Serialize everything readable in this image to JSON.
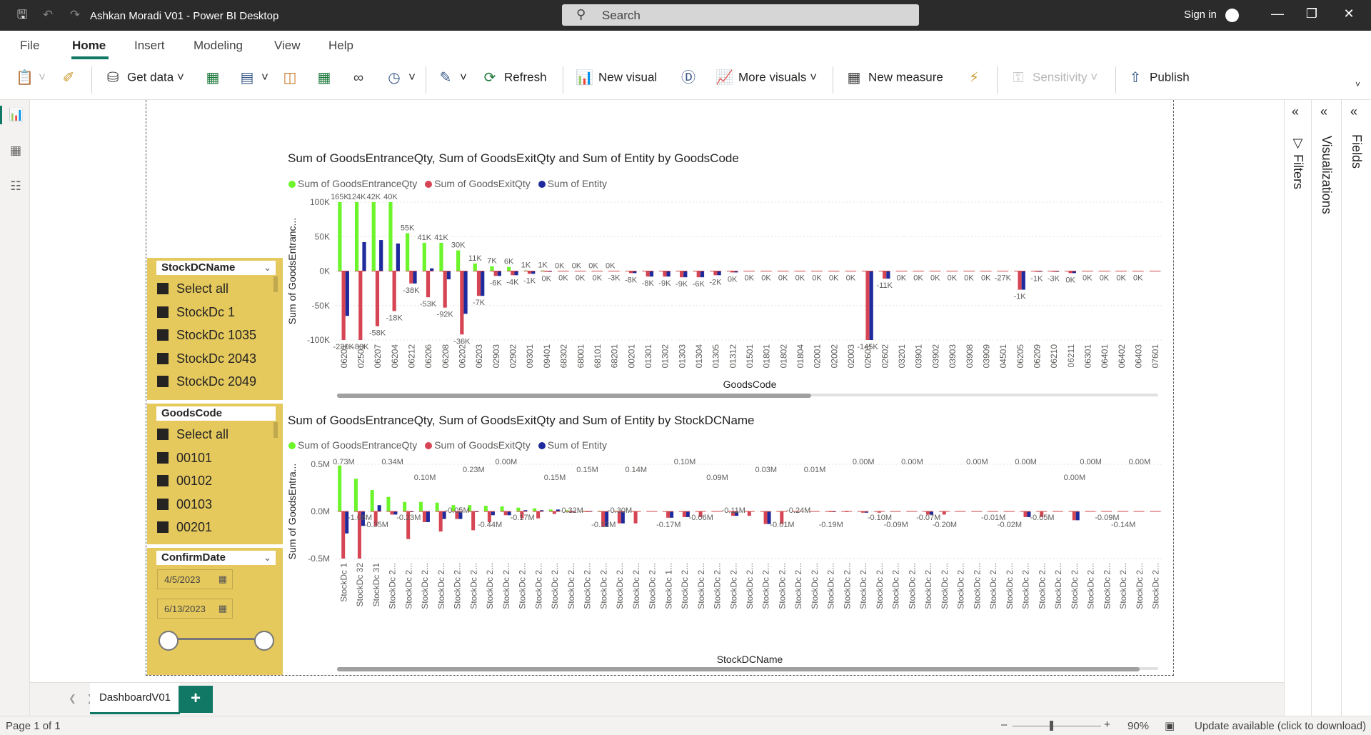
{
  "window": {
    "title": "Ashkan Moradi V01 - Power BI Desktop",
    "search_placeholder": "Search",
    "sign_in": "Sign in"
  },
  "menu": [
    "File",
    "Home",
    "Insert",
    "Modeling",
    "View",
    "Help"
  ],
  "ribbon": {
    "get_data": "Get data",
    "refresh": "Refresh",
    "new_visual": "New visual",
    "more_visuals": "More visuals",
    "new_measure": "New measure",
    "sensitivity": "Sensitivity",
    "publish": "Publish"
  },
  "panes": {
    "filters": "Filters",
    "visualizations": "Visualizations",
    "fields": "Fields"
  },
  "slicers": {
    "stock": {
      "header": "StockDCName",
      "items": [
        "Select all",
        "StockDc 1",
        "StockDc 1035",
        "StockDc 2043",
        "StockDc 2049"
      ]
    },
    "goods": {
      "header": "GoodsCode",
      "items": [
        "Select all",
        "00101",
        "00102",
        "00103",
        "00201"
      ]
    },
    "date": {
      "header": "ConfirmDate",
      "from": "4/5/2023",
      "to": "6/13/2023"
    }
  },
  "colors": {
    "entrance": "#6cf52b",
    "exit": "#d64554",
    "entity": "#1f2a9c",
    "accent": "#117865",
    "slicer_bg": "#e5c95d"
  },
  "chart_data": [
    {
      "type": "bar",
      "title": "Sum of GoodsEntranceQty, Sum of GoodsExitQty and Sum of Entity by GoodsCode",
      "xlabel": "GoodsCode",
      "ylabel": "Sum of GoodsEntranc...",
      "ylim": [
        -100000,
        100000
      ],
      "yticks": [
        "100K",
        "50K",
        "0K",
        "-50K",
        "-100K"
      ],
      "grid": true,
      "legend": "top-left",
      "categories": [
        "06201",
        "02501",
        "06207",
        "06204",
        "06212",
        "06206",
        "06208",
        "06202",
        "06203",
        "02903",
        "02902",
        "09301",
        "09401",
        "68302",
        "68001",
        "68101",
        "68201",
        "00201",
        "01301",
        "01302",
        "01303",
        "01304",
        "01305",
        "01312",
        "01501",
        "01801",
        "01802",
        "01804",
        "02001",
        "02002",
        "02003",
        "02601",
        "02602",
        "03201",
        "03901",
        "03902",
        "03903",
        "03908",
        "03909",
        "04501",
        "06205",
        "06209",
        "06210",
        "06211",
        "06301",
        "06401",
        "06402",
        "06403",
        "07601"
      ],
      "series": [
        {
          "name": "Sum of GoodsEntranceQty",
          "values": [
            165000,
            124000,
            124000,
            135000,
            55000,
            41000,
            41000,
            30000,
            11000,
            7000,
            6000,
            1000,
            1000,
            0,
            0,
            0,
            0,
            0,
            0,
            0,
            0,
            0,
            0,
            0,
            0,
            0,
            0,
            0,
            0,
            0,
            0,
            0,
            0,
            0,
            0,
            0,
            0,
            0,
            0,
            0,
            0,
            0,
            0,
            0,
            0,
            0,
            0,
            0,
            0
          ]
        },
        {
          "name": "Sum of GoodsExitQty",
          "values": [
            -230000,
            -100000,
            -80000,
            -58000,
            -18000,
            -38000,
            -53000,
            -92000,
            -36000,
            -7000,
            -6000,
            -4000,
            -1000,
            0,
            0,
            0,
            0,
            -3000,
            -8000,
            -8000,
            -9000,
            -9000,
            -6000,
            -2000,
            0,
            0,
            0,
            0,
            0,
            0,
            0,
            -145000,
            -11000,
            0,
            0,
            0,
            0,
            0,
            0,
            0,
            -27000,
            -1000,
            -1000,
            -3000,
            0,
            0,
            0,
            0,
            0
          ]
        },
        {
          "name": "Sum of Entity",
          "values": [
            -65000,
            42000,
            45000,
            40000,
            -18000,
            4000,
            -12000,
            -62000,
            -36000,
            -7000,
            -6000,
            -4000,
            -1000,
            0,
            0,
            0,
            0,
            -3000,
            -8000,
            -8000,
            -9000,
            -9000,
            -6000,
            -2000,
            0,
            0,
            0,
            0,
            0,
            0,
            0,
            -145000,
            -11000,
            0,
            0,
            0,
            0,
            0,
            0,
            0,
            -27000,
            -1000,
            -1000,
            -3000,
            0,
            0,
            0,
            0,
            0
          ]
        }
      ],
      "data_labels": [
        [
          "165K",
          "124K",
          "42K",
          "40K",
          "55K",
          "41K",
          "41K",
          "30K",
          "11K",
          "7K",
          "6K",
          "1K",
          "1K",
          "0K",
          "0K",
          "0K",
          "0K",
          "",
          "",
          "",
          "",
          "",
          "",
          "",
          "",
          "",
          "",
          "",
          "",
          "",
          "",
          "",
          "",
          "",
          "",
          "",
          "",
          "",
          "",
          "",
          "",
          "",
          "",
          "",
          "",
          "",
          "",
          "",
          ""
        ],
        [
          "-230K",
          "-80K",
          "-58K",
          "-18K",
          "-38K",
          "-53K",
          "-92K",
          "-36K",
          "-7K",
          "-6K",
          "-4K",
          "-1K",
          "0K",
          "0K",
          "0K",
          "0K",
          "-3K",
          "-8K",
          "-8K",
          "-9K",
          "-9K",
          "-6K",
          "-2K",
          "0K",
          "0K",
          "0K",
          "0K",
          "0K",
          "0K",
          "0K",
          "0K",
          "-145K",
          "-11K",
          "0K",
          "0K",
          "0K",
          "0K",
          "0K",
          "0K",
          "-27K",
          "-1K",
          "-1K",
          "-3K",
          "0K",
          "0K",
          "0K",
          "0K",
          "0K",
          ""
        ],
        [
          "-65K",
          "45K",
          "4K",
          "-12K",
          "-62K",
          "0K"
        ]
      ]
    },
    {
      "type": "bar",
      "title": "Sum of GoodsEntranceQty, Sum of GoodsExitQty and Sum of Entity by StockDCName",
      "xlabel": "StockDCName",
      "ylabel": "Sum of GoodsEntra...",
      "ylim": [
        -0.75,
        0.75
      ],
      "yticks": [
        "0.5M",
        "0.0M",
        "-0.5M"
      ],
      "grid": true,
      "legend": "top-left",
      "categories": [
        "StockDc 1",
        "StockDc 32",
        "StockDc 31",
        "StockDc 2...",
        "StockDc 2...",
        "StockDc 2...",
        "StockDc 2...",
        "StockDc 2...",
        "StockDc 2...",
        "StockDc 2...",
        "StockDc 2...",
        "StockDc 2...",
        "StockDc 2...",
        "StockDc 2...",
        "StockDc 2...",
        "StockDc 2...",
        "StockDc 2...",
        "StockDc 2...",
        "StockDc 2...",
        "StockDc 2...",
        "StockDc 1...",
        "StockDc 2...",
        "StockDc 2...",
        "StockDc 2...",
        "StockDc 2...",
        "StockDc 2...",
        "StockDc 2...",
        "StockDc 2...",
        "StockDc 2...",
        "StockDc 2...",
        "StockDc 2...",
        "StockDc 2...",
        "StockDc 2...",
        "StockDc 2...",
        "StockDc 2...",
        "StockDc 2...",
        "StockDc 2...",
        "StockDc 2...",
        "StockDc 2...",
        "StockDc 2...",
        "StockDc 2...",
        "StockDc 2...",
        "StockDc 2...",
        "StockDc 2...",
        "StockDc 2...",
        "StockDc 2...",
        "StockDc 2...",
        "StockDc 2...",
        "StockDc 2...",
        "StockDc 2...",
        "StockDc 2..."
      ],
      "series": [
        {
          "name": "Sum of GoodsEntranceQty",
          "values": [
            0.73,
            0.52,
            0.34,
            0.23,
            0.15,
            0.15,
            0.14,
            0.1,
            0.1,
            0.09,
            0.08,
            0.06,
            0.05,
            0.03,
            0.02,
            0.01,
            0.01,
            0.01,
            0,
            0,
            0,
            0,
            0,
            0,
            0,
            0,
            0,
            0,
            0,
            0,
            0,
            0,
            0,
            0,
            0,
            0,
            0,
            0,
            0,
            0,
            0,
            0,
            0,
            0,
            0,
            0,
            0,
            0,
            0,
            0,
            0
          ]
        },
        {
          "name": "Sum of GoodsExitQty",
          "values": [
            -1.08,
            -0.8,
            -0.23,
            -0.05,
            -0.44,
            -0.17,
            -0.32,
            -0.12,
            -0.3,
            -0.17,
            -0.06,
            -0.11,
            -0.11,
            -0.04,
            -0.02,
            -0.01,
            -0.24,
            -0.19,
            -0.19,
            0,
            -0.1,
            -0.09,
            -0.09,
            0,
            -0.07,
            -0.07,
            -0.2,
            -0.2,
            0,
            0,
            -0.01,
            -0.01,
            -0.02,
            -0.02,
            0,
            0,
            -0.05,
            -0.05,
            0,
            0,
            0,
            0,
            -0.09,
            -0.09,
            0,
            -0.14,
            0,
            0,
            0,
            0,
            0
          ]
        },
        {
          "name": "Sum of Entity",
          "values": [
            -0.35,
            -0.23,
            0.1,
            -0.05,
            -0.01,
            -0.17,
            -0.12,
            -0.12,
            -0.01,
            -0.06,
            -0.06,
            0.02,
            0.02,
            0.03,
            0.01,
            0.01,
            -0.24,
            -0.19,
            0,
            0,
            -0.1,
            -0.09,
            0,
            0,
            -0.07,
            0,
            -0.2,
            0,
            0,
            0,
            -0.01,
            0,
            -0.02,
            0,
            0,
            0,
            -0.05,
            0,
            0,
            0,
            0,
            0,
            -0.09,
            0,
            0,
            -0.14,
            0,
            0,
            0,
            0,
            0
          ]
        }
      ],
      "data_labels": [
        "0.73M",
        "-1.08M",
        "-0.35M",
        "0.34M",
        "-0.23M",
        "0.10M",
        "-0.05M",
        "0.23M",
        "-0.44M",
        "0.00M",
        "-0.17M",
        "0.15M",
        "-0.32M",
        "0.15M",
        "-0.12M",
        "-0.30M",
        "0.14M",
        "-0.17M",
        "0.10M",
        "-0.06M",
        "0.09M",
        "-0.11M",
        "0.03M",
        "-0.01M",
        "-0.24M",
        "0.01M",
        "-0.19M",
        "0.00M",
        "-0.10M",
        "-0.09M",
        "0.00M",
        "-0.07M",
        "-0.20M",
        "0.00M",
        "-0.01M",
        "-0.02M",
        "0.00M",
        "-0.05M",
        "0.00M",
        "0.00M",
        "-0.09M",
        "-0.14M",
        "0.00M"
      ]
    }
  ],
  "tabs": {
    "page": "DashboardV01",
    "add": "+"
  },
  "status": {
    "page": "Page 1 of 1",
    "zoom": "90%",
    "update": "Update available (click to download)"
  }
}
